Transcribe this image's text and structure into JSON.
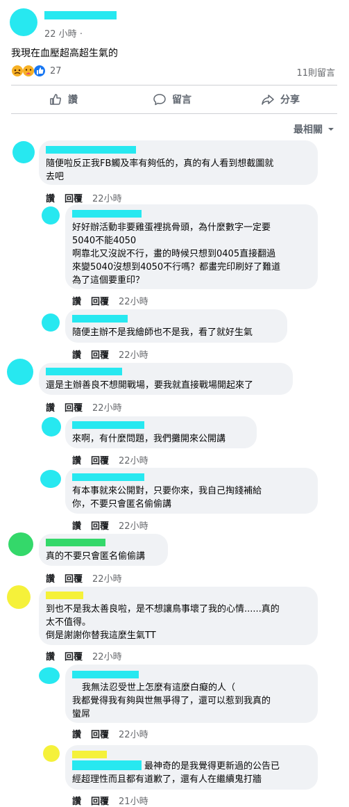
{
  "post": {
    "time": "22 小時",
    "time_dot": "·",
    "text": "我現在血壓超高超生氣的",
    "reaction_count": "27",
    "comments_count": "11則留言"
  },
  "actions": {
    "like": "讚",
    "comment": "留言",
    "share": "分享"
  },
  "sort": {
    "label": "最相關"
  },
  "comment_actions": {
    "like": "讚",
    "reply": "回覆"
  },
  "comments": [
    {
      "text": "隨便啦反正我FB觸及率有夠低的，真的有人看到想截圖就\n去吧",
      "time": "22小時"
    },
    {
      "text": "好好辦活動非要雞蛋裡挑骨頭，為什麼數字一定要\n5040不能4050\n啊靠北又沒說不行，畫的時候只想到0405直接翻過\n來變5040沒想到4050不行嗎？都畫完印刷好了難道\n為了這個要重印？",
      "time": "22小時"
    },
    {
      "text": "隨便主辦不是我繪師也不是我，看了就好生氣",
      "time": "22小時"
    },
    {
      "text": "還是主辦善良不想開戰場，要我就直接戰場開起來了",
      "time": "22小時"
    },
    {
      "text": "來啊，有什麼問題，我們攤開來公開講",
      "time": "22小時"
    },
    {
      "text": "有本事就來公開對，只要你來，我自己掏錢補給\n你，不要只會匿名偷偷講",
      "time": "22小時"
    },
    {
      "text": "真的不要只會匿名偷偷講",
      "time": "22小時"
    },
    {
      "text": "到也不是我太善良啦，是不想讓鳥事壞了我的心情......真的\n太不值得。\n倒是謝謝你替我這麼生氣TT",
      "time": "22小時"
    },
    {
      "text": "我無法忍受世上怎麼有這麼白癡的人（\n我都覺得我有夠與世無爭得了，還可以惹到我真的\n蠻屌",
      "time": "22小時"
    },
    {
      "text": "最神奇的是我覺得更新過的公告已\n經超理性而且都有道歉了，還有人在繼續鬼打牆",
      "time": "21小時"
    }
  ],
  "colors": {
    "cyan_mark": "#27e8f0",
    "green_mark": "#34d86a",
    "yellow_mark": "#f5f13a",
    "facebook_blue": "#385898",
    "like_blue": "#1877f2"
  },
  "icons": [
    "like-icon",
    "comment-icon",
    "share-icon",
    "chevron-down-icon",
    "angry-reaction-icon",
    "care-reaction-icon",
    "like-reaction-icon"
  ]
}
